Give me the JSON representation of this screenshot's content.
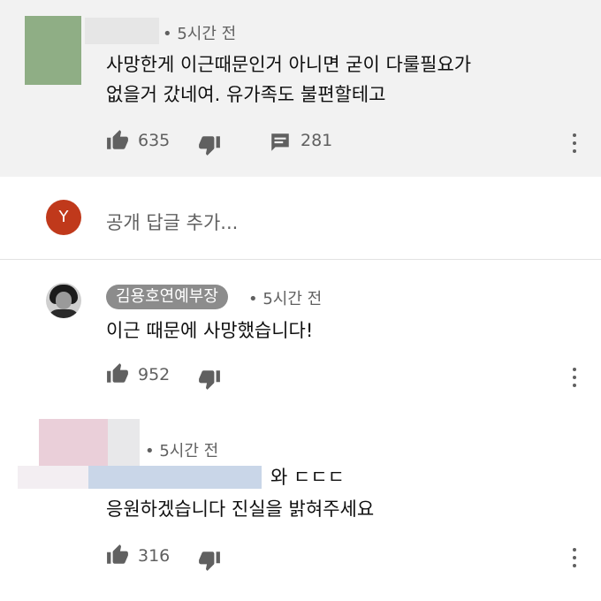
{
  "comments": [
    {
      "time": "• 5시간 전",
      "lines": [
        "사망한게 이근때문인거 아니면 굳이 다룰필요가",
        "없을거 갔네여. 유가족도 불편할테고"
      ],
      "likes": "635",
      "replies": "281"
    },
    {
      "author": "김용호연예부장",
      "time": "• 5시간 전",
      "lines": [
        "이근 때문에 사망했습니다!"
      ],
      "likes": "952"
    },
    {
      "time": "• 5시간 전",
      "lines": [
        "와 ㄷㄷㄷ",
        "응원하겠습니다 진실을 밝혀주세요"
      ],
      "likes": "316"
    }
  ],
  "reply_box": {
    "avatar_letter": "Y",
    "placeholder": "공개 답글 추가..."
  },
  "colors": {
    "top_bg": "#f2f2f2",
    "avatar_red": "#c0391b",
    "author_pill": "#8c8c8c",
    "icon_gray": "#606060"
  },
  "icons": [
    "thumb-up-icon",
    "thumb-down-icon",
    "comment-icon",
    "more-vert-icon"
  ]
}
